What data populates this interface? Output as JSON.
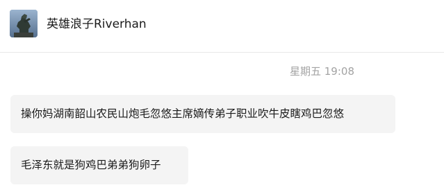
{
  "contact": {
    "name": "英雄浪子Riverhan",
    "avatar_icon": "user-avatar-statue-photo"
  },
  "conversation": {
    "timestamp": "星期五 19:08",
    "messages": [
      {
        "text": "操你妈湖南韶山农民山炮毛忽悠主席嫡传弟子职业吹牛皮瞎鸡巴忽悠"
      },
      {
        "text": "毛泽东就是狗鸡巴弟弟狗卵子"
      }
    ]
  },
  "colors": {
    "divider": "#e8e8e8",
    "bubble_background": "#f4f4f4",
    "timestamp_text": "#a3a3a3",
    "text": "#1a1a1a"
  }
}
